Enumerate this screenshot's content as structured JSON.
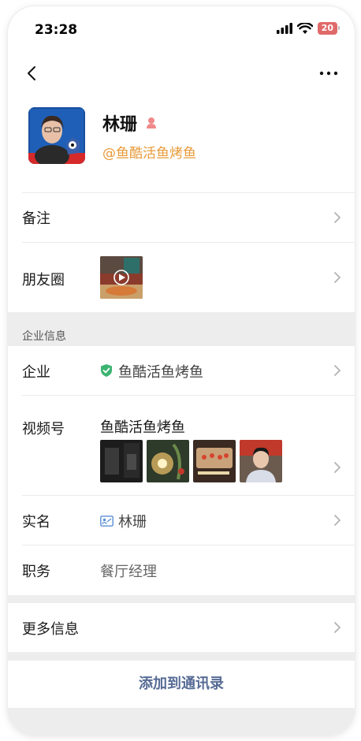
{
  "status_bar": {
    "time": "23:28",
    "battery": "20"
  },
  "profile": {
    "name": "林珊",
    "company_tag": "@鱼酷活鱼烤鱼"
  },
  "rows": {
    "remark": {
      "label": "备注"
    },
    "moments": {
      "label": "朋友圈"
    },
    "section_title": "企业信息",
    "company": {
      "label": "企业",
      "value": "鱼酷活鱼烤鱼"
    },
    "channels": {
      "label": "视频号",
      "value": "鱼酷活鱼烤鱼"
    },
    "realname": {
      "label": "实名",
      "value": "林珊"
    },
    "position": {
      "label": "职务",
      "value": "餐厅经理"
    },
    "more_info": {
      "label": "更多信息"
    }
  },
  "actions": {
    "add_contact": "添加到通讯录"
  },
  "colors": {
    "accent_orange": "#e89a3a",
    "link_blue": "#576b95",
    "verified_green": "#3cb371"
  }
}
